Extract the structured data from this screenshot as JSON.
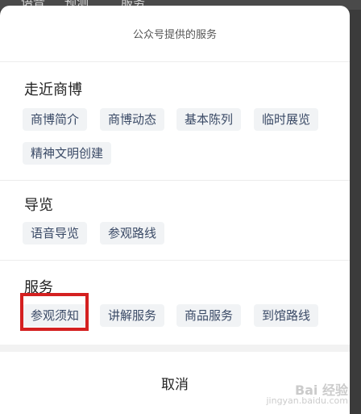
{
  "background_tabs": [
    "语音",
    "预测",
    "服务"
  ],
  "sheet": {
    "title": "公众号提供的服务",
    "sections": [
      {
        "title": "走近商博",
        "items": [
          "商博简介",
          "商博动态",
          "基本陈列",
          "临时展览",
          "精神文明创建"
        ]
      },
      {
        "title": "导览",
        "items": [
          "语音导览",
          "参观路线"
        ]
      },
      {
        "title": "服务",
        "items": [
          "参观须知",
          "讲解服务",
          "商品服务",
          "到馆路线"
        ]
      }
    ],
    "cancel_label": "取消"
  },
  "highlight": {
    "target": "参观须知",
    "color": "#d42020"
  },
  "watermark": {
    "logo": "Bai 经验",
    "url": "jingyan.baidu.com"
  },
  "colors": {
    "chip_bg": "#f1f3f5",
    "chip_text": "#3a4a66",
    "overlay": "#3b3b3b"
  }
}
